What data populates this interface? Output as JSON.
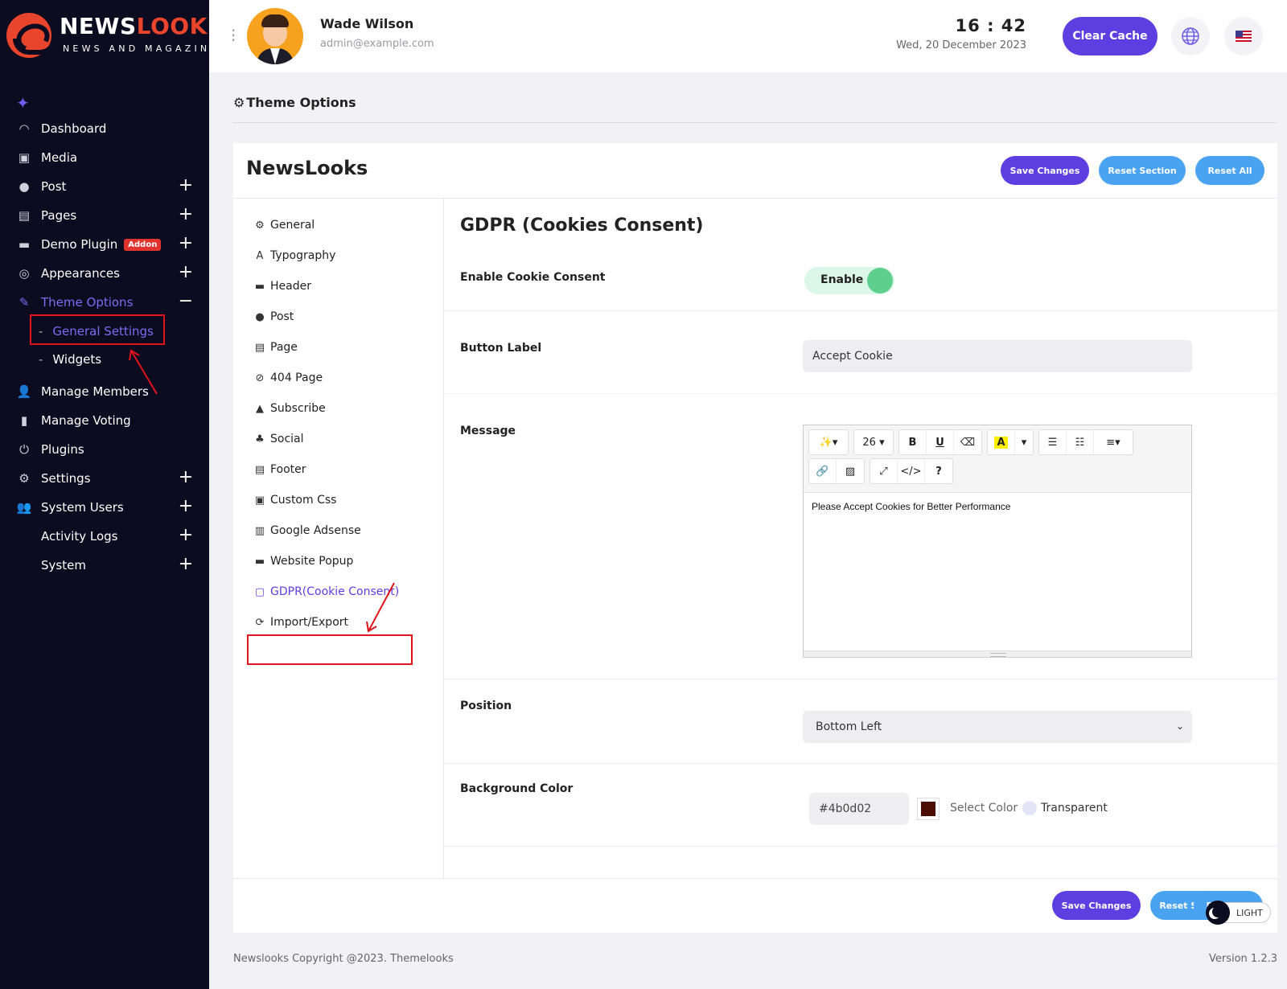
{
  "brand": {
    "title_a": "NEWS",
    "title_b": "LOOKS",
    "subtitle": "NEWS AND MAGAZINE"
  },
  "sidebar": {
    "items": [
      {
        "label": "Dashboard",
        "icon": "speedometer-icon",
        "expand": ""
      },
      {
        "label": "Media",
        "icon": "media-icon",
        "expand": ""
      },
      {
        "label": "Post",
        "icon": "post-icon",
        "expand": "+"
      },
      {
        "label": "Pages",
        "icon": "pages-icon",
        "expand": "+"
      },
      {
        "label": "Demo Plugin",
        "icon": "plugin-icon",
        "expand": "+",
        "badge": "Addon"
      },
      {
        "label": "Appearances",
        "icon": "appearance-icon",
        "expand": "+"
      },
      {
        "label": "Theme Options",
        "icon": "brush-icon",
        "expand": "−"
      },
      {
        "label": "Manage Members",
        "icon": "user-icon",
        "expand": ""
      },
      {
        "label": "Manage Voting",
        "icon": "chart-icon",
        "expand": ""
      },
      {
        "label": "Plugins",
        "icon": "power-icon",
        "expand": ""
      },
      {
        "label": "Settings",
        "icon": "gear-icon",
        "expand": "+"
      },
      {
        "label": "System Users",
        "icon": "users-icon",
        "expand": "+"
      },
      {
        "label": "Activity Logs",
        "icon": "",
        "expand": "+"
      },
      {
        "label": "System",
        "icon": "",
        "expand": "+"
      }
    ],
    "subitems": [
      {
        "label": "General Settings"
      },
      {
        "label": "Widgets"
      }
    ]
  },
  "topbar": {
    "user_name": "Wade Wilson",
    "user_email": "admin@example.com",
    "time": "16 : 42",
    "date": "Wed, 20 December 2023",
    "clear_cache": "Clear Cache"
  },
  "page": {
    "title": "Theme Options"
  },
  "card": {
    "title": "NewsLooks",
    "save": "Save Changes",
    "reset_section": "Reset Section",
    "reset_all": "Reset All"
  },
  "sections": [
    {
      "label": "General",
      "icon": "gears-icon"
    },
    {
      "label": "Typography",
      "icon": "font-icon"
    },
    {
      "label": "Header",
      "icon": "header-icon"
    },
    {
      "label": "Post",
      "icon": "post-icon"
    },
    {
      "label": "Page",
      "icon": "page-icon"
    },
    {
      "label": "404 Page",
      "icon": "ban-icon"
    },
    {
      "label": "Subscribe",
      "icon": "subscribe-icon"
    },
    {
      "label": "Social",
      "icon": "social-icon"
    },
    {
      "label": "Footer",
      "icon": "footer-icon"
    },
    {
      "label": "Custom Css",
      "icon": "css-icon"
    },
    {
      "label": "Google Adsense",
      "icon": "adsense-icon"
    },
    {
      "label": "Website Popup",
      "icon": "popup-icon"
    },
    {
      "label": "GDPR(Cookie Consent)",
      "icon": "cookie-doc-icon"
    },
    {
      "label": "Import/Export",
      "icon": "sync-icon"
    }
  ],
  "gdpr": {
    "title": "GDPR (Cookies Consent)",
    "enable_label": "Enable Cookie Consent",
    "enable_value": "Enable",
    "button_label_label": "Button Label",
    "button_label_value": "Accept Cookie",
    "message_label": "Message",
    "font_size": "26",
    "message_value": "Please Accept Cookies for Better Performance",
    "position_label": "Position",
    "position_value": "Bottom Left",
    "bg_label": "Background Color",
    "bg_value": "#4b0d02",
    "select_color": "Select Color",
    "transparent": "Transparent"
  },
  "colors": {
    "accent": "#5b3fe0",
    "secondary": "#4aa3f1",
    "swatch": "#4b0d02",
    "toggle_on": "#5fcf8d"
  },
  "theme_toggle": "LIGHT",
  "footer": {
    "copyright": "Newslooks Copyright @2023. Themelooks",
    "version": "Version 1.2.3"
  }
}
